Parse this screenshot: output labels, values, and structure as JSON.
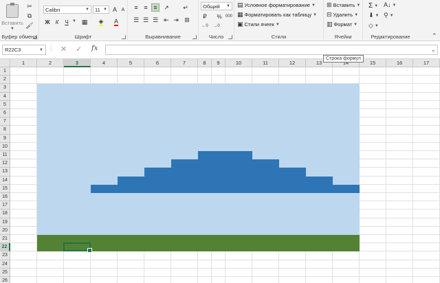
{
  "ribbon": {
    "clipboard": {
      "paste_label": "Вставить",
      "group_label": "Буфер обмена"
    },
    "font": {
      "font_name": "Calibri",
      "font_size": "11",
      "bold": "Ж",
      "italic": "К",
      "underline": "Ч",
      "group_label": "Шрифт"
    },
    "alignment": {
      "group_label": "Выравнивание"
    },
    "number": {
      "format": "Общий",
      "percent": "%",
      "thousands": "000",
      "group_label": "Число"
    },
    "styles": {
      "conditional": "Условное форматирование",
      "as_table": "Форматировать как таблицу",
      "cell_styles": "Стили ячеек",
      "group_label": "Стили"
    },
    "cells": {
      "insert": "Вставить",
      "delete": "Удалить",
      "format": "Формат",
      "group_label": "Ячейки"
    },
    "editing": {
      "sum": "Σ",
      "group_label": "Редактирование"
    }
  },
  "formula_bar": {
    "name_box": "R22C3",
    "cancel": "✕",
    "enter": "✓",
    "fx": "fx",
    "value": "",
    "tooltip": "Строка формул"
  },
  "sheet": {
    "selected_col": 3,
    "selected_row": 22,
    "column_labels": [
      "1",
      "2",
      "3",
      "4",
      "5",
      "6",
      "7",
      "8",
      "9",
      "10",
      "11",
      "12",
      "13",
      "14",
      "15",
      "16",
      "17"
    ],
    "row_labels": [
      "1",
      "2",
      "3",
      "4",
      "5",
      "6",
      "7",
      "8",
      "9",
      "10",
      "11",
      "12",
      "13",
      "14",
      "15",
      "16",
      "17",
      "18",
      "19",
      "20",
      "21",
      "22",
      "23",
      "24",
      "25",
      "26"
    ],
    "colors": {
      "sky": "#bdd7ee",
      "mountain": "#2e75b6",
      "ground": "#548235",
      "accent": "#217346"
    }
  }
}
